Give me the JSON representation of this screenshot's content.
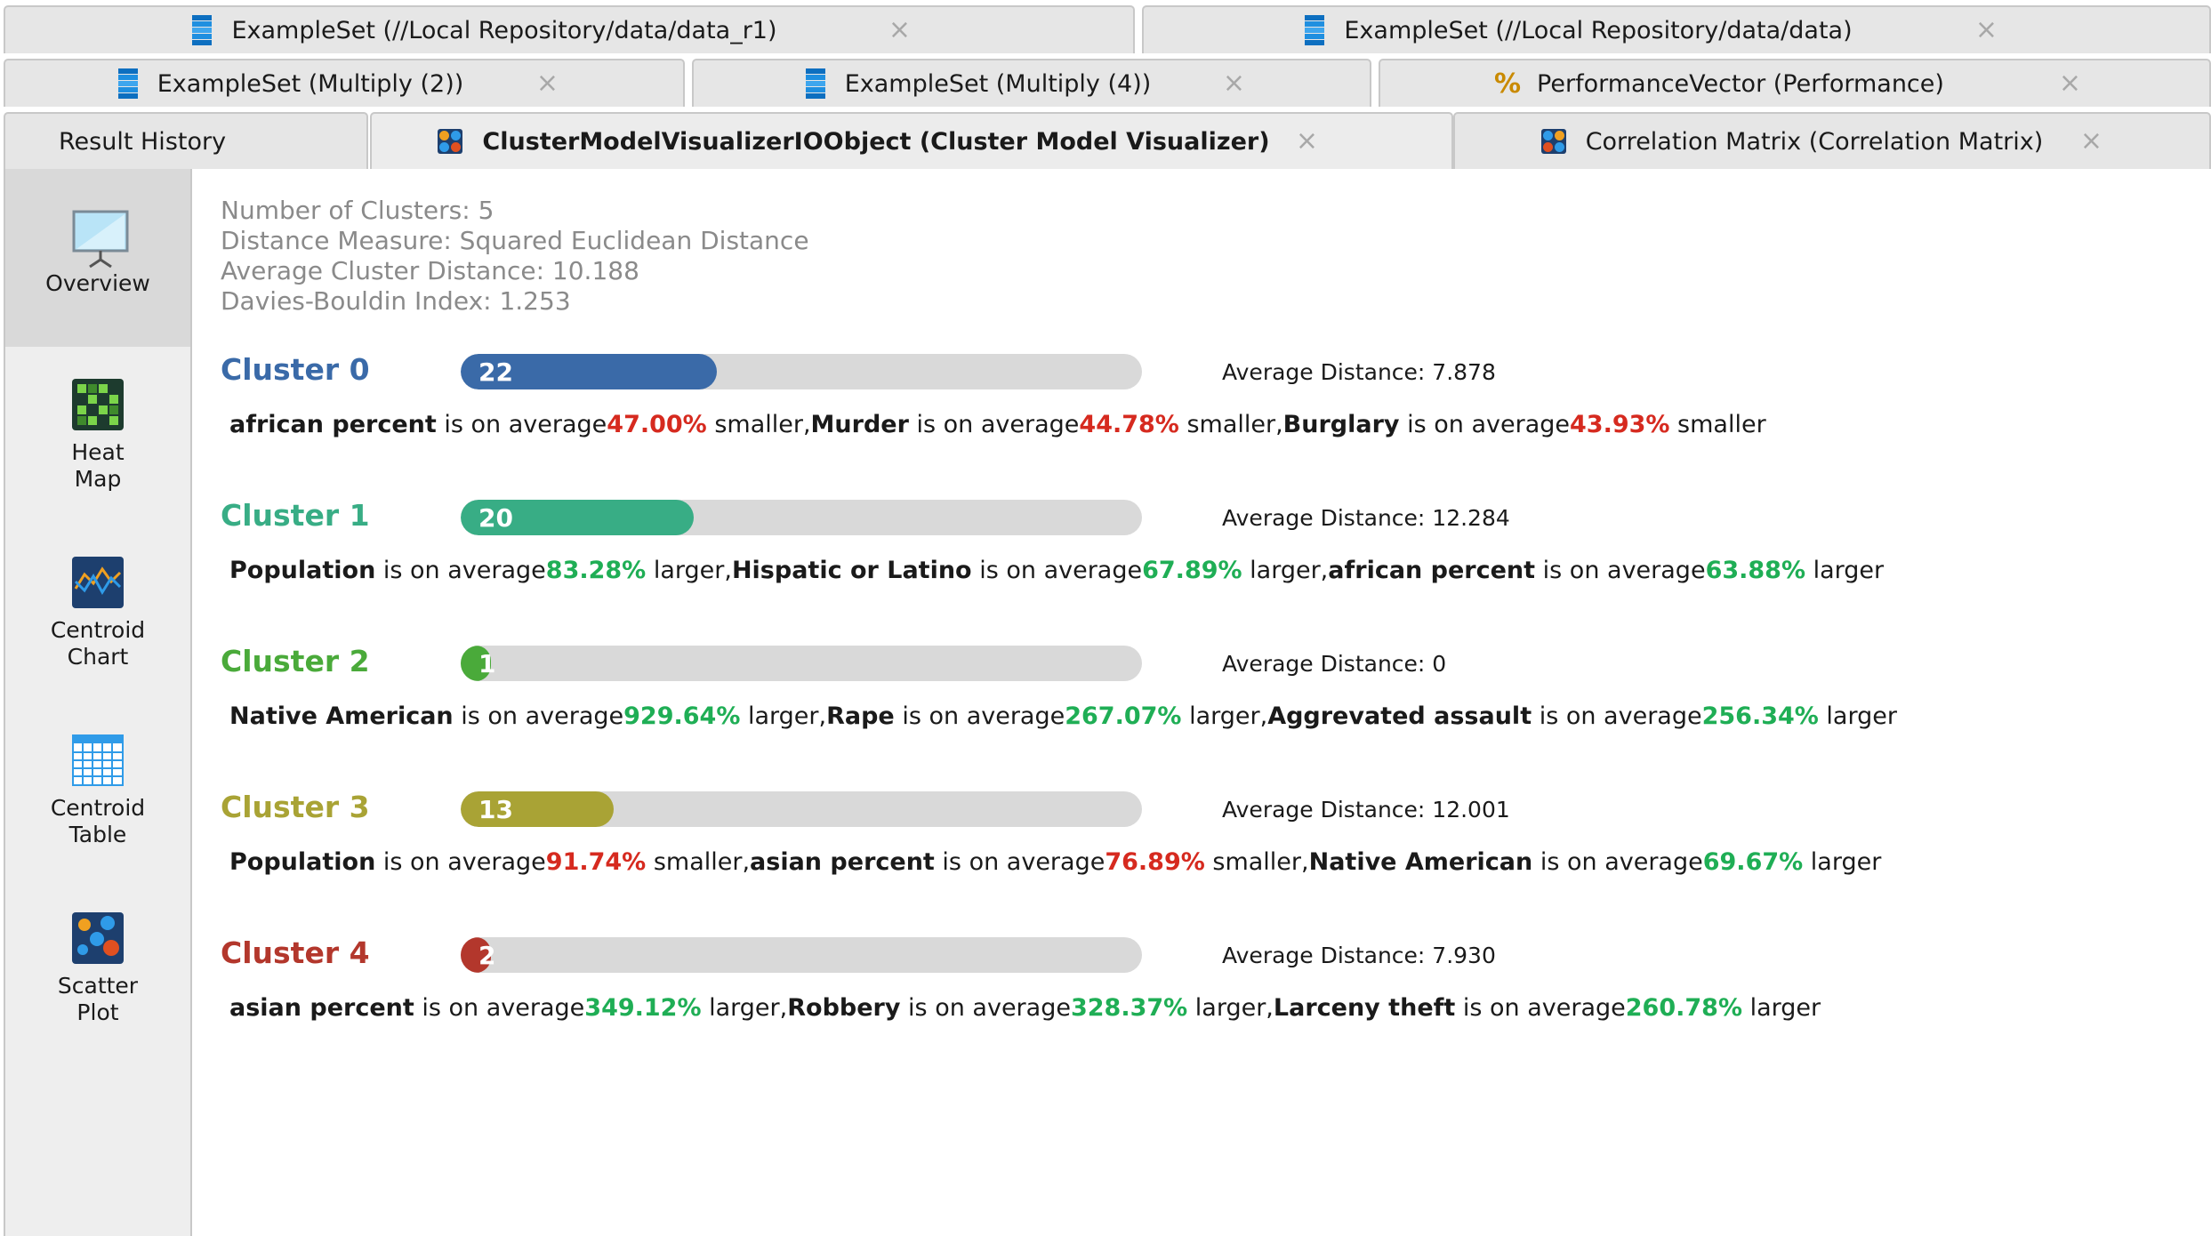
{
  "tabs": {
    "row1": [
      {
        "label": "ExampleSet (//Local Repository/data/data_r1)",
        "icon": "dataset-icon"
      },
      {
        "label": "ExampleSet (//Local Repository/data/data)",
        "icon": "dataset-icon"
      }
    ],
    "row2": [
      {
        "label": "ExampleSet (Multiply (2))",
        "icon": "dataset-icon"
      },
      {
        "label": "ExampleSet (Multiply (4))",
        "icon": "dataset-icon"
      },
      {
        "label": "PerformanceVector (Performance)",
        "icon": "performance-icon"
      }
    ],
    "row3": [
      {
        "label": "Result History"
      },
      {
        "label": "ClusterModelVisualizerIOObject (Cluster Model Visualizer)",
        "icon": "cluster-model-icon",
        "active": true
      },
      {
        "label": "Correlation Matrix (Correlation Matrix)",
        "icon": "correlation-matrix-icon"
      }
    ],
    "close_glyph": "×"
  },
  "sidebar": {
    "items": [
      {
        "label": "Overview",
        "icon": "presentation-screen-icon",
        "active": true
      },
      {
        "label": "Heat\nMap",
        "icon": "heat-map-icon"
      },
      {
        "label": "Centroid\nChart",
        "icon": "centroid-chart-icon"
      },
      {
        "label": "Centroid\nTable",
        "icon": "centroid-table-icon"
      },
      {
        "label": "Scatter\nPlot",
        "icon": "scatter-plot-icon"
      }
    ]
  },
  "summary": {
    "num_clusters": "Number of Clusters: 5",
    "distance_measure": "Distance Measure: Squared Euclidean Distance",
    "avg_cluster_distance": "Average Cluster Distance: 10.188",
    "davies_bouldin": "Davies-Bouldin Index: 1.253"
  },
  "colors": {
    "cluster0": "#3a6aa8",
    "cluster1": "#38ad85",
    "cluster2": "#4aaa3a",
    "cluster3": "#a9a335",
    "cluster4": "#b3372c",
    "smaller": "#d62a1f",
    "larger": "#1fae55"
  },
  "clusters": [
    {
      "title": "Cluster 0",
      "count": "22",
      "fill_fraction": 0.376,
      "avg_distance": "Average Distance: 7.878",
      "desc": [
        {
          "attr": "african percent",
          "mid": " is on average",
          "pct": "47.00%",
          "dir": "smaller",
          "word": " smaller,"
        },
        {
          "attr": "Murder",
          "mid": " is on average",
          "pct": "44.78%",
          "dir": "smaller",
          "word": " smaller,"
        },
        {
          "attr": "Burglary",
          "mid": " is on average",
          "pct": "43.93%",
          "dir": "smaller",
          "word": " smaller"
        }
      ]
    },
    {
      "title": "Cluster 1",
      "count": "20",
      "fill_fraction": 0.342,
      "avg_distance": "Average Distance: 12.284",
      "desc": [
        {
          "attr": "Population",
          "mid": " is on average",
          "pct": "83.28%",
          "dir": "larger",
          "word": " larger,"
        },
        {
          "attr": "Hispatic or Latino",
          "mid": " is on average",
          "pct": "67.89%",
          "dir": "larger",
          "word": " larger,"
        },
        {
          "attr": "african percent",
          "mid": " is on average",
          "pct": "63.88%",
          "dir": "larger",
          "word": " larger"
        }
      ]
    },
    {
      "title": "Cluster 2",
      "count": "1",
      "fill_fraction": 0.017,
      "avg_distance": "Average Distance: 0",
      "desc": [
        {
          "attr": "Native American",
          "mid": " is on average",
          "pct": "929.64%",
          "dir": "larger",
          "word": " larger,"
        },
        {
          "attr": "Rape",
          "mid": " is on average",
          "pct": "267.07%",
          "dir": "larger",
          "word": " larger,"
        },
        {
          "attr": "Aggrevated assault",
          "mid": " is on average",
          "pct": "256.34%",
          "dir": "larger",
          "word": " larger"
        }
      ]
    },
    {
      "title": "Cluster 3",
      "count": "13",
      "fill_fraction": 0.224,
      "avg_distance": "Average Distance: 12.001",
      "desc": [
        {
          "attr": "Population",
          "mid": " is on average",
          "pct": "91.74%",
          "dir": "smaller",
          "word": " smaller,"
        },
        {
          "attr": "asian percent",
          "mid": " is on average",
          "pct": "76.89%",
          "dir": "smaller",
          "word": " smaller,"
        },
        {
          "attr": "Native American",
          "mid": " is on average",
          "pct": "69.67%",
          "dir": "larger",
          "word": " larger"
        }
      ]
    },
    {
      "title": "Cluster 4",
      "count": "2",
      "fill_fraction": 0.034,
      "avg_distance": "Average Distance: 7.930",
      "desc": [
        {
          "attr": "asian percent",
          "mid": " is on average",
          "pct": "349.12%",
          "dir": "larger",
          "word": " larger,"
        },
        {
          "attr": "Robbery",
          "mid": " is on average",
          "pct": "328.37%",
          "dir": "larger",
          "word": " larger,"
        },
        {
          "attr": "Larceny theft",
          "mid": " is on average",
          "pct": "260.78%",
          "dir": "larger",
          "word": " larger"
        }
      ]
    }
  ]
}
